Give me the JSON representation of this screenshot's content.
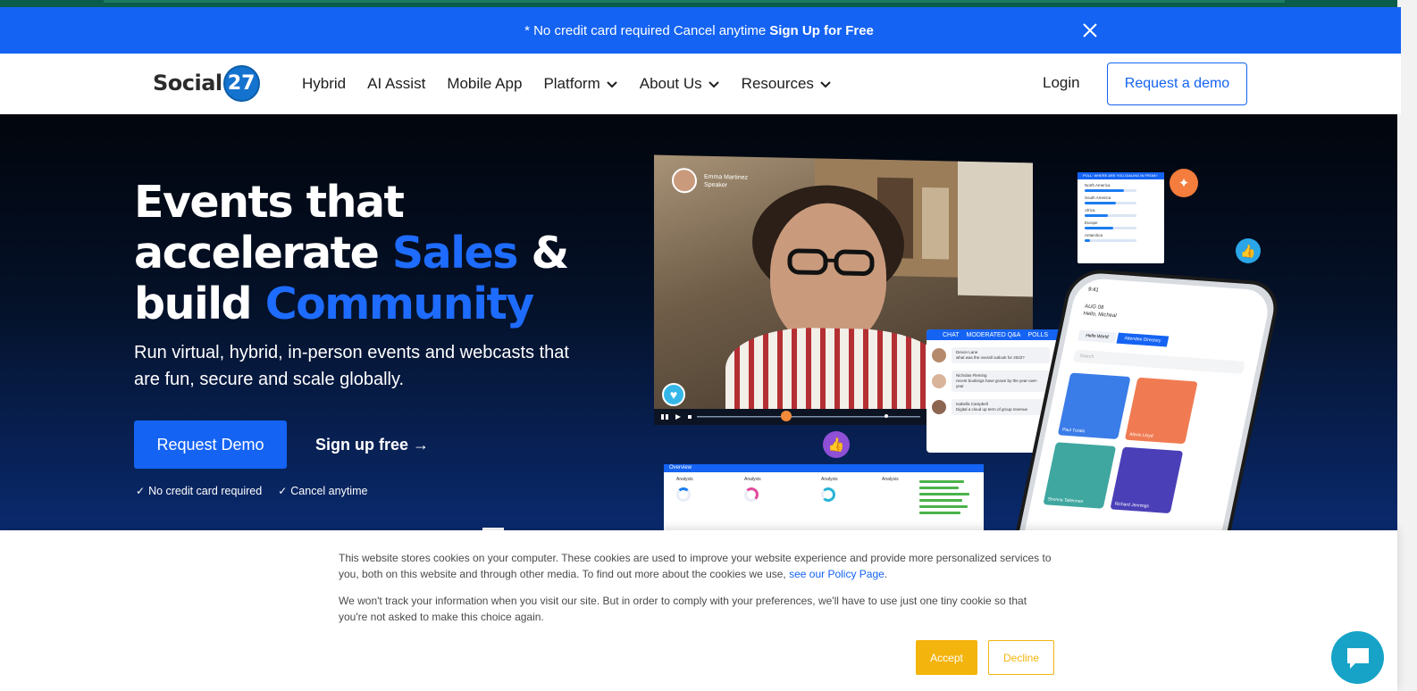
{
  "announcement": {
    "prefix": "* No credit card required  Cancel anytime",
    "link": "Sign Up for Free",
    "close_icon": "close-icon"
  },
  "nav": {
    "logo_text": "Social",
    "logo_number": "27",
    "items": [
      {
        "label": "Hybrid",
        "dropdown": false
      },
      {
        "label": "AI Assist",
        "dropdown": false
      },
      {
        "label": "Mobile App",
        "dropdown": false
      },
      {
        "label": "Platform",
        "dropdown": true
      },
      {
        "label": "About Us",
        "dropdown": true
      },
      {
        "label": "Resources",
        "dropdown": true
      }
    ],
    "login": "Login",
    "demo_button": "Request a demo"
  },
  "hero": {
    "line1": "Events that",
    "line2_a": "accelerate ",
    "line2_b": "Sales",
    "line2_c": " &",
    "line3_a": "build ",
    "line3_b": "Community",
    "subtitle": "Run virtual, hybrid, in-person events and webcasts that are fun, secure and scale globally.",
    "cta_primary": "Request Demo",
    "cta_secondary": "Sign up free →",
    "checks": [
      "No credit card required",
      "Cancel anytime"
    ]
  },
  "visual": {
    "speaker_name": "Emma Martinez",
    "speaker_role": "Speaker",
    "chat_tabs": [
      "CHAT",
      "MODERATED Q&A",
      "POLLS"
    ],
    "chat_messages": [
      {
        "name": "Devon Lane",
        "text": "what was the overall outlook for 2022?"
      },
      {
        "name": "Nicholas Fleming",
        "text": "recent bookings have grown by the year-over-year"
      },
      {
        "name": "Isabella Campbell",
        "text": "Digital a cloud up term of group revenue"
      }
    ],
    "poll_title": "POLL: WHERE ARE YOU DIALING IN FROM?",
    "poll_rows": [
      {
        "label": "North America",
        "pct": 0.75
      },
      {
        "label": "South America",
        "pct": 0.6
      },
      {
        "label": "Africa",
        "pct": 0.45
      },
      {
        "label": "Europe",
        "pct": 0.55
      },
      {
        "label": "Antarctica",
        "pct": 0.1
      }
    ],
    "analytics_title": "Overview",
    "analytics_cols": [
      "Analysis",
      "Analysis",
      "Analysis",
      "Analysis"
    ],
    "phone_time": "9:41",
    "phone_date": "AUG 08",
    "phone_hello": "Hello, Micheal",
    "phone_tabs": [
      "Hello World",
      "Attendee Directory"
    ],
    "phone_search": "Search",
    "phone_people": [
      "Paul Turala",
      "Alexis Lloyd",
      "Shonna Tallerman",
      "Richard Jennings"
    ],
    "phone_card_colors": [
      "#3a7ce8",
      "#f07b52",
      "#3fa7a0",
      "#4b3fb8"
    ]
  },
  "cookie": {
    "p1": "This website stores cookies on your computer. These cookies are used to improve your website experience and provide more personalized services to you, both on this website and through other media. To find out more about the cookies we use, ",
    "p1_link": "see our Policy Page",
    "p1_end": ".",
    "p2": "We won't track your information when you visit our site. But in order to comply with your preferences, we'll have to use just one tiny cookie so that you're not asked to make this choice again.",
    "accept": "Accept",
    "decline": "Decline"
  },
  "colors": {
    "brand_blue": "#1463f3",
    "accent_yellow": "#f3b40d",
    "chat_widget": "#16a3c7"
  }
}
